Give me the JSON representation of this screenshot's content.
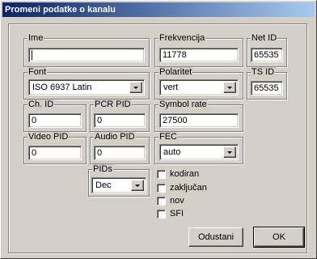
{
  "window": {
    "title": "Promeni podatke o kanalu"
  },
  "groups": {
    "ime": {
      "label": "Ime",
      "value": ""
    },
    "frekvencija": {
      "label": "Frekvencija",
      "value": "11778"
    },
    "net_id": {
      "label": "Net ID",
      "value": "65535"
    },
    "font": {
      "label": "Font",
      "value": "ISO 6937 Latin"
    },
    "polaritet": {
      "label": "Polaritet",
      "value": "vert"
    },
    "ts_id": {
      "label": "TS ID",
      "value": "65535"
    },
    "ch_id": {
      "label": "Ch. ID",
      "value": "0"
    },
    "pcr_pid": {
      "label": "PCR PID",
      "value": "0"
    },
    "symbol_rate": {
      "label": "Symbol rate",
      "value": "27500"
    },
    "video_pid": {
      "label": "Video PID",
      "value": "0"
    },
    "audio_pid": {
      "label": "Audio PID",
      "value": "0"
    },
    "fec": {
      "label": "FEC",
      "value": "auto"
    },
    "pids": {
      "label": "PIDs",
      "value": "Dec"
    }
  },
  "checkboxes": [
    {
      "label": "kodiran",
      "checked": false
    },
    {
      "label": "zaključan",
      "checked": false
    },
    {
      "label": "nov",
      "checked": false
    },
    {
      "label": "SFI",
      "checked": false
    }
  ],
  "buttons": {
    "cancel": "Odustani",
    "ok": "OK"
  }
}
